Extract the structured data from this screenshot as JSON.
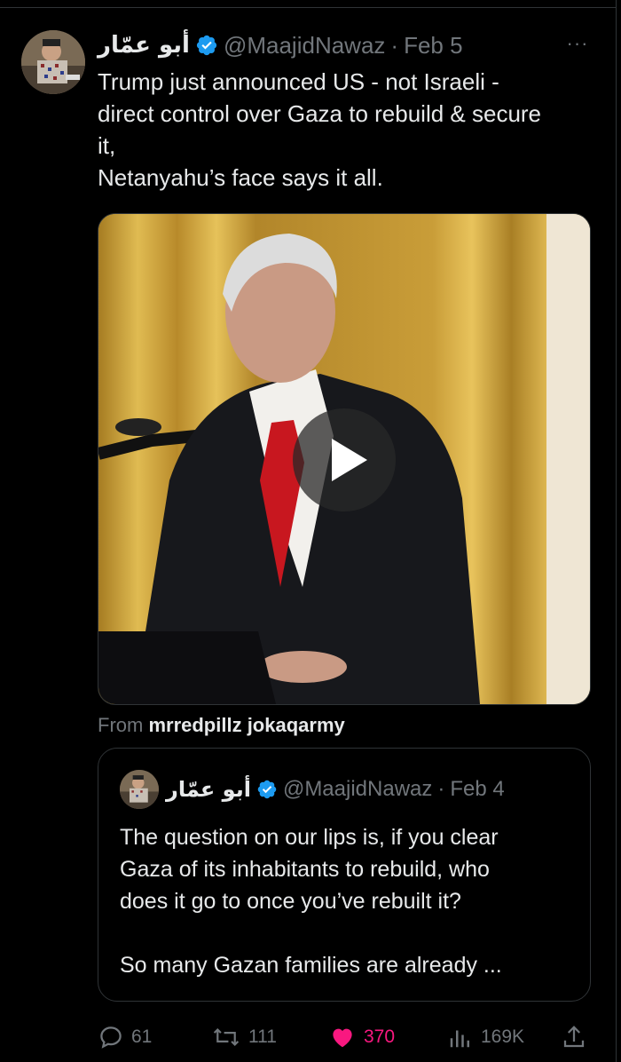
{
  "tweet": {
    "display_name": "أبو عمّار",
    "handle": "@MaajidNawaz",
    "separator": "·",
    "date": "Feb 5",
    "more_label": "···",
    "text": "Trump just announced US - not Israeli -\ndirect control over Gaza to rebuild & secure\nit,\nNetanyahu’s face says it all.",
    "media": {
      "type": "video",
      "play_icon": "play-icon"
    },
    "from_prefix": "From",
    "from_source": "mrredpillz jokaqarmy"
  },
  "quoted_tweet": {
    "display_name": "أبو عمّار",
    "handle": "@MaajidNawaz",
    "separator": "·",
    "date": "Feb 4",
    "text": "The question on our lips is, if you clear\nGaza of its inhabitants to rebuild, who\ndoes it go to once you’ve rebuilt it?\n\nSo many Gazan families are already ..."
  },
  "actions": {
    "replies": "61",
    "reposts": "111",
    "likes": "370",
    "views": "169K"
  },
  "colors": {
    "background": "#000000",
    "text": "#e7e9ea",
    "muted": "#71767b",
    "verified": "#1d9bf0",
    "like": "#f91880",
    "border": "#2f3336"
  }
}
